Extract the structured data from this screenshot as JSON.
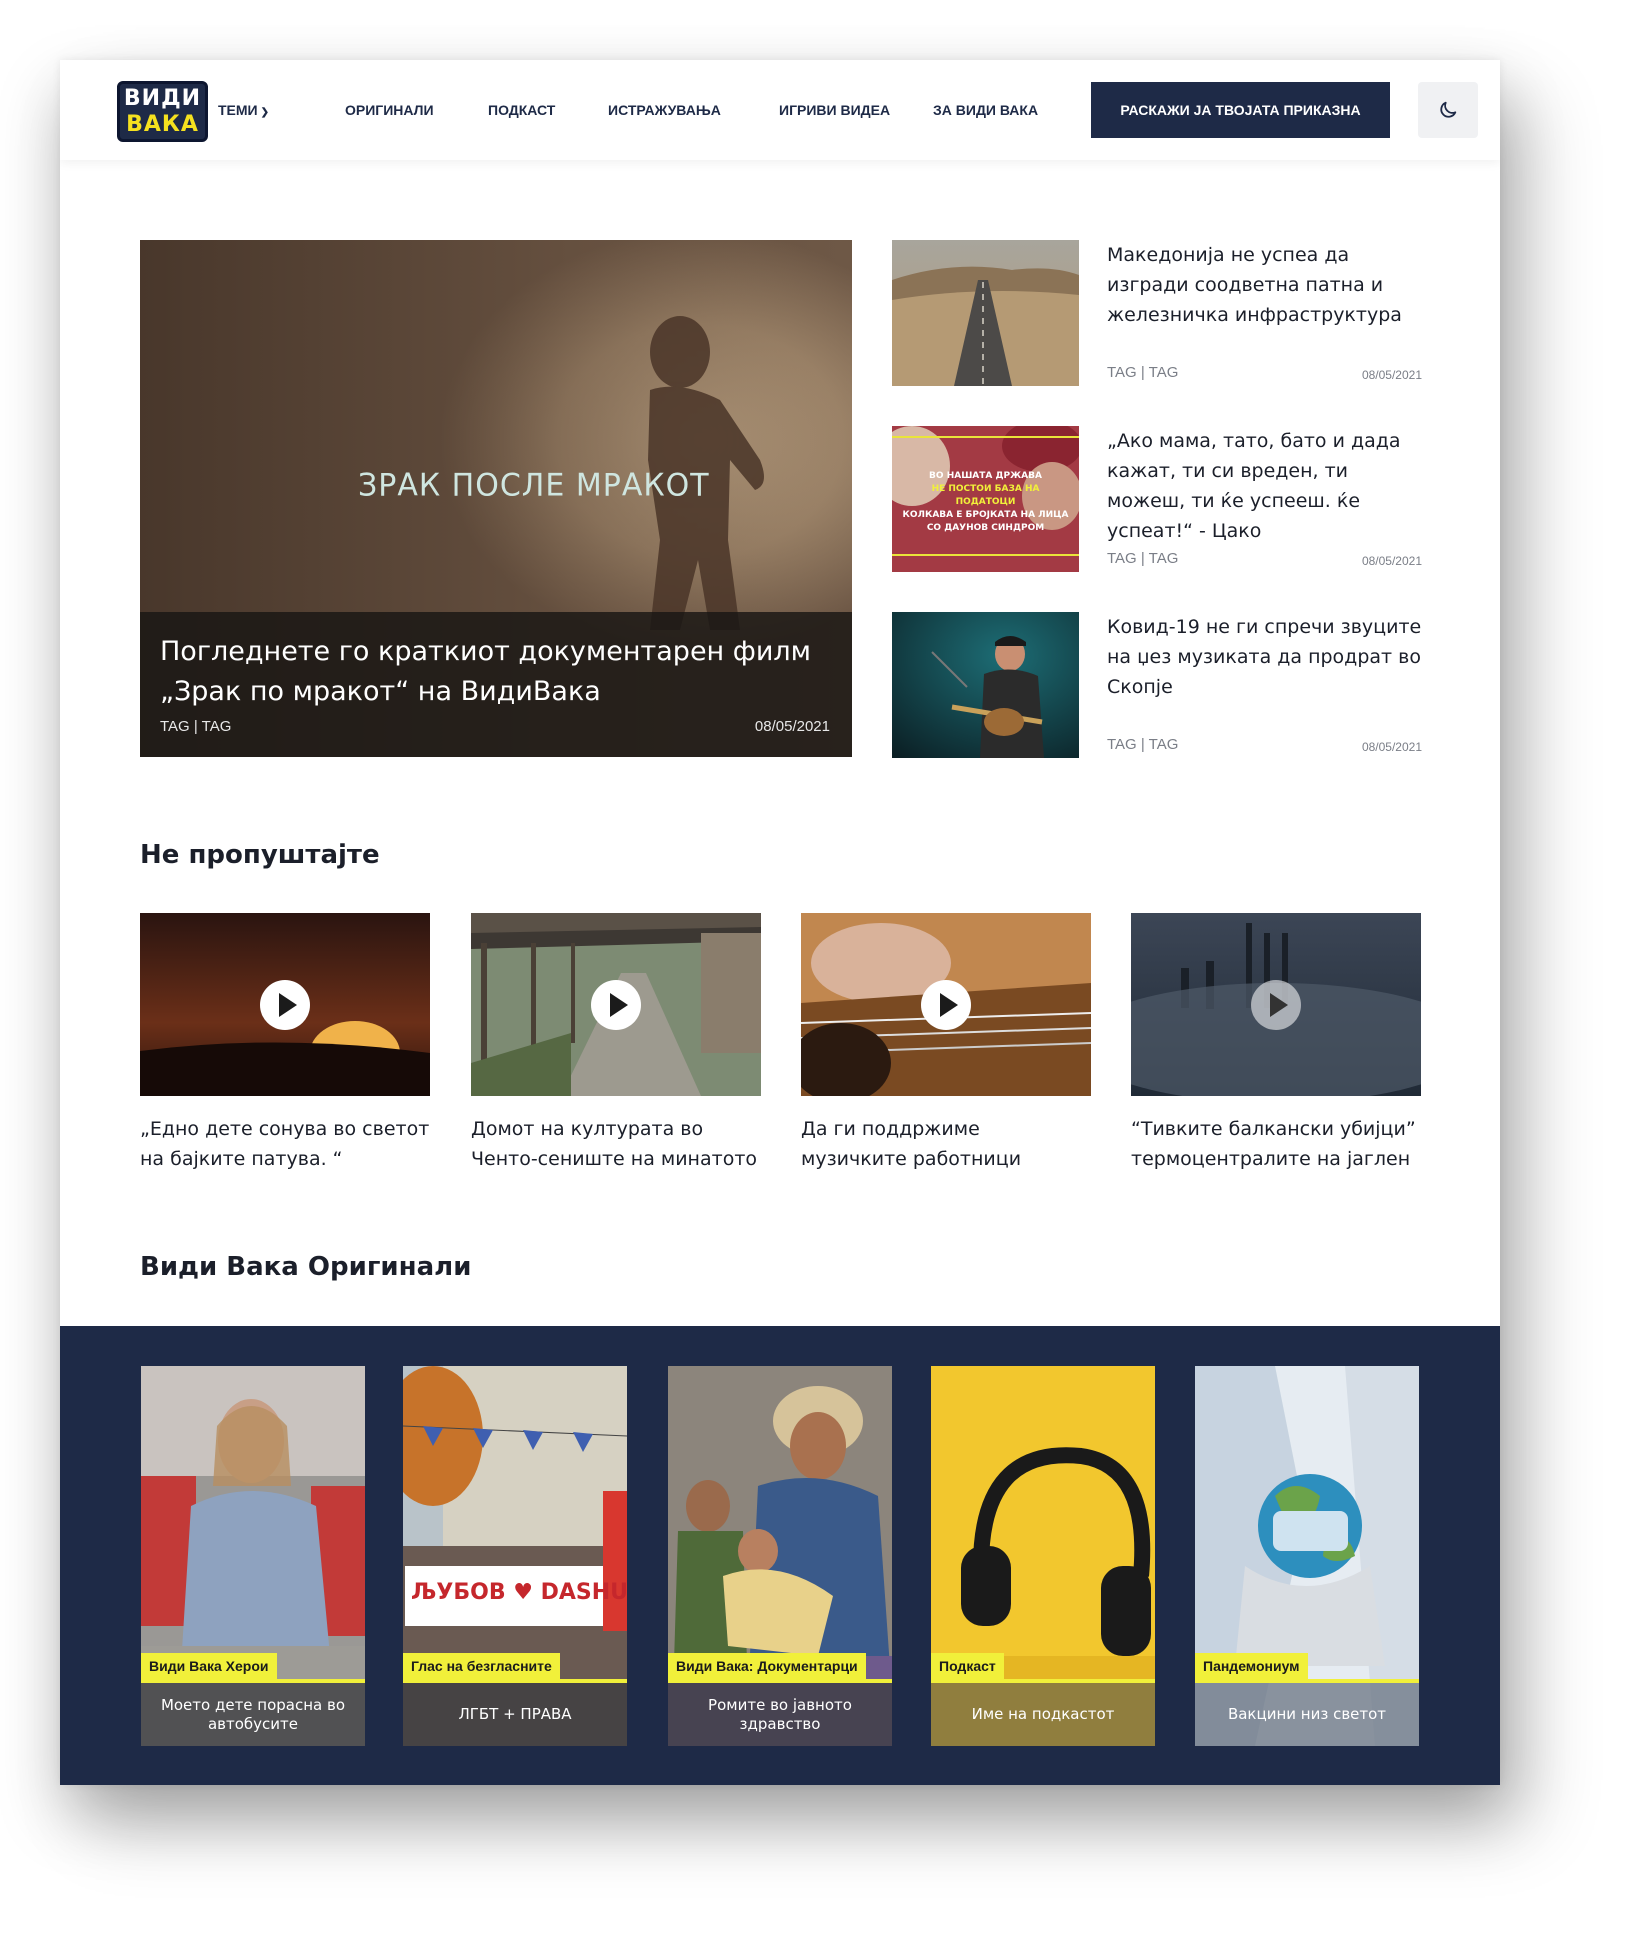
{
  "header": {
    "logo_line1": "ВИДИ",
    "logo_line2": "ВАКА",
    "nav": [
      "ТЕМИ",
      "ОРИГИНАЛИ",
      "ПОДКАСТ",
      "ИСТРАЖУВАЊА",
      "ИГРИВИ ВИДЕА",
      "ЗА ВИДИ ВАКА"
    ],
    "nav_dropdown_icon": "chevron-down-icon",
    "cta_label": "РАСКАЖИ ЈА ТВОЈАТА ПРИКАЗНА",
    "theme_icon": "moon-icon"
  },
  "hero": {
    "overlay_text": "ЗРАК ПОСЛЕ МРАКОТ",
    "title": "Погледнете го краткиот документарен филм „Зрак по мракот“ на ВидиВака",
    "tags": "TAG | TAG",
    "date": "08/05/2021"
  },
  "side_articles": [
    {
      "title": "Македонија не успеа да изгради соодветна патна и железничка инфраструктура",
      "tags": "TAG | TAG",
      "date": "08/05/2021"
    },
    {
      "title": "„Ако мама, тато, бато и дада кажат, ти си вреден, ти можеш, ти ќе успееш. ќе успеат!“ - Цако",
      "tags": "TAG | TAG",
      "date": "08/05/2021",
      "thumb_text": [
        "ВО НАШАТА ДРЖАВА",
        "НЕ ПОСТОИ БАЗА НА ПОДАТОЦИ",
        "КОЛКАВА Е БРОЈКАТА НА ЛИЦА",
        "СО ДАУНОВ СИНДРОМ"
      ]
    },
    {
      "title": "Ковид-19 не ги спречи звуците на џез музиката да продрат во Скопје",
      "tags": "TAG | TAG",
      "date": "08/05/2021"
    }
  ],
  "dont_miss": {
    "title": "Не пропуштајте",
    "videos": [
      {
        "title": "„Едно дете сонува во светот на бајките патува. “"
      },
      {
        "title": "Домот на културата во Ченто-сениште на минатото"
      },
      {
        "title": "Да ги поддржиме музичките работници"
      },
      {
        "title": "“Тивките балкански убијци” термоцентралите на јаглен"
      }
    ]
  },
  "originals": {
    "title": "Види Вака Оригинали",
    "cards": [
      {
        "label": "Види Вака Херои",
        "caption": "Моето дете порасна во автобусите"
      },
      {
        "label": "Глас на безгласните",
        "caption": "ЛГБТ + ПРАВА",
        "photo_text": "ЉУБОВ ♥ DASHU"
      },
      {
        "label": "Види Вака: Документарци",
        "caption": "Ромите во јавното здравство"
      },
      {
        "label": "Подкаст",
        "caption": "Име на подкастот"
      },
      {
        "label": "Пандемониум",
        "caption": "Вакцини низ светот"
      }
    ]
  },
  "colors": {
    "navy": "#1e2a47",
    "accent_yellow": "#f1f03a",
    "text": "#1b1f2a",
    "muted": "#7a7e87"
  }
}
